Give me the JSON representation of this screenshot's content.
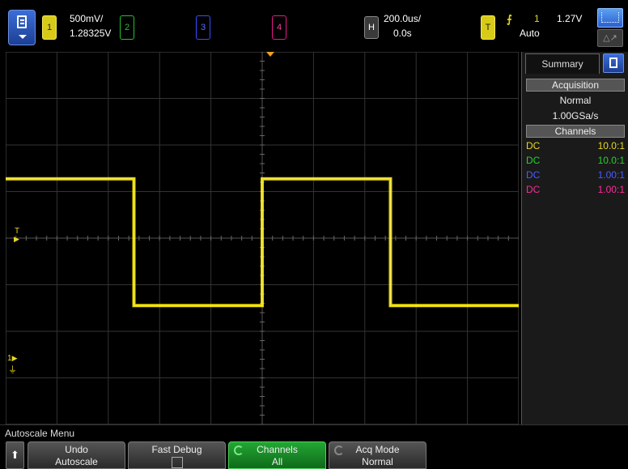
{
  "top": {
    "ch1": {
      "num": "1",
      "scale": "500mV/",
      "offset": "1.28325V"
    },
    "ch2": {
      "num": "2"
    },
    "ch3": {
      "num": "3"
    },
    "ch4": {
      "num": "4"
    },
    "horiz": {
      "label": "H",
      "scale": "200.0us/",
      "delay": "0.0s"
    },
    "trig": {
      "label": "T",
      "source": "1",
      "level": "1.27V",
      "mode": "Auto"
    }
  },
  "plot": {
    "ground_marker": "1",
    "trigger_marker": "T"
  },
  "waveform": {
    "color": "#ffee00",
    "high_level_v": 1.92,
    "low_level_v": 0.56,
    "period_us": 1000,
    "first_high_start_us": -1000
  },
  "panel": {
    "tab": "Summary",
    "acq_header": "Acquisition",
    "acq_mode": "Normal",
    "sample_rate": "1.00GSa/s",
    "channels_header": "Channels",
    "channels": [
      {
        "coupling": "DC",
        "probe": "10.0:1",
        "color": "#e8d820"
      },
      {
        "coupling": "DC",
        "probe": "10.0:1",
        "color": "#22d42a"
      },
      {
        "coupling": "DC",
        "probe": "1.00:1",
        "color": "#4a5cff"
      },
      {
        "coupling": "DC",
        "probe": "1.00:1",
        "color": "#ff2a9a"
      }
    ]
  },
  "softkeys": {
    "menu_title": "Autoscale Menu",
    "undo": [
      "Undo",
      "Autoscale"
    ],
    "fast_debug": "Fast Debug",
    "channels": [
      "Channels",
      "All"
    ],
    "acq_mode": [
      "Acq Mode",
      "Normal"
    ]
  }
}
